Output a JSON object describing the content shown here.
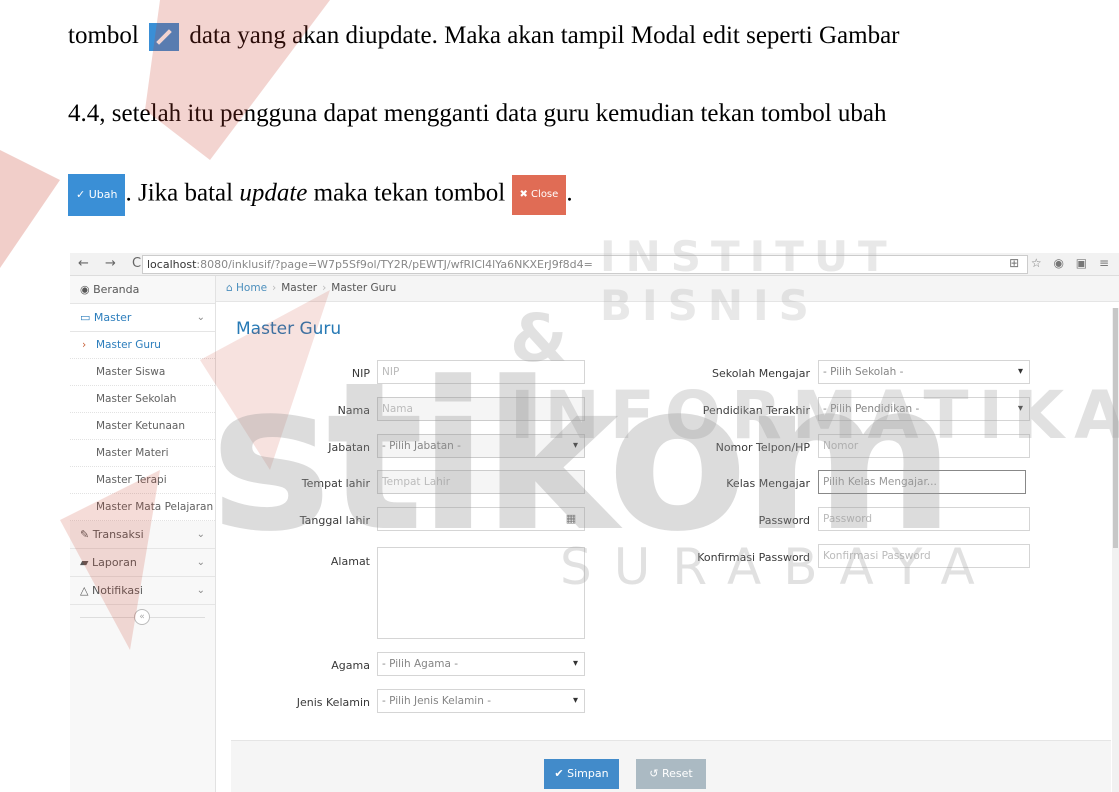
{
  "document": {
    "line1_prefix": "tombol",
    "line1_suffix": "data yang akan diupdate. Maka akan tampil Modal edit seperti Gambar",
    "line2": "4.4, setelah itu pengguna dapat mengganti data guru kemudian tekan tombol ubah",
    "ubah_button_label": "✓ Ubah",
    "line3_mid": ". Jika batal",
    "line3_italic": "update",
    "line3_end": "maka tekan tombol",
    "close_button_label": "✖ Close",
    "line3_period": "."
  },
  "watermark": {
    "line1": "INSTITUT BISNIS",
    "line2": "& INFORMATIKA",
    "line3": "stikom",
    "line4": "SURABAYA"
  },
  "browser": {
    "nav_symbols": "← → C",
    "url_host": "localhost",
    "url_path": ":8080/inklusif/?page=W7p5Sf9ol/TY2R/pEWTJ/wfRICl4lYa6NKXErJ9f8d4=",
    "toolbar_icons": "⊞ ☆ ◉ ▣ ≡"
  },
  "sidebar": {
    "beranda": "Beranda",
    "master": "Master",
    "master_items": [
      "Master Guru",
      "Master Siswa",
      "Master Sekolah",
      "Master Ketunaan",
      "Master Materi",
      "Master Terapi",
      "Master Mata Pelajaran"
    ],
    "transaksi": "Transaksi",
    "laporan": "Laporan",
    "notifikasi": "Notifikasi",
    "collapse_symbol": "«"
  },
  "breadcrumb": {
    "home": "Home",
    "level1": "Master",
    "level2": "Master Guru",
    "sep": "›"
  },
  "page_title": "Master Guru",
  "form": {
    "nip_label": "NIP",
    "nip_placeholder": "NIP",
    "nama_label": "Nama",
    "nama_placeholder": "Nama",
    "jabatan_label": "Jabatan",
    "jabatan_value": "- Pilih Jabatan -",
    "tempat_lahir_label": "Tempat lahir",
    "tempat_lahir_placeholder": "Tempat Lahir",
    "tanggal_lahir_label": "Tanggal lahir",
    "alamat_label": "Alamat",
    "agama_label": "Agama",
    "agama_value": "- Pilih Agama -",
    "jenis_kelamin_label": "Jenis Kelamin",
    "jenis_kelamin_value": "- Pilih Jenis Kelamin -",
    "sekolah_label": "Sekolah Mengajar",
    "sekolah_value": "- Pilih Sekolah -",
    "pendidikan_label": "Pendidikan Terakhir",
    "pendidikan_value": "- Pilih Pendidikan -",
    "nomor_label": "Nomor Telpon/HP",
    "nomor_placeholder": "Nomor",
    "kelas_label": "Kelas Mengajar",
    "kelas_placeholder": "Pilih Kelas Mengajar...",
    "password_label": "Password",
    "password_placeholder": "Password",
    "konfirmasi_label": "Konfirmasi Password",
    "konfirmasi_placeholder": "Konfirmasi Password",
    "simpan_label": "✔ Simpan",
    "reset_label": "↺ Reset"
  }
}
